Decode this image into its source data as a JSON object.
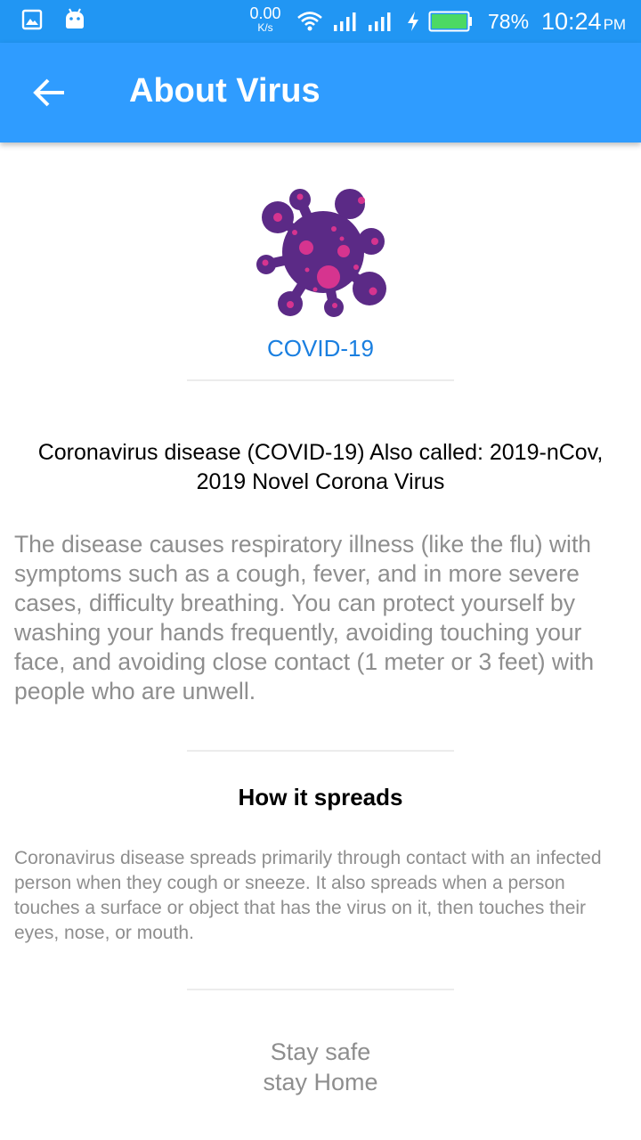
{
  "status_bar": {
    "left_icons": [
      "image-icon",
      "android-icon"
    ],
    "speed_value": "0.00",
    "speed_unit": "K/s",
    "battery_percent": "78%",
    "time": "10:24",
    "ampm": "PM",
    "right_icons": [
      "wifi-icon",
      "signal-icon",
      "signal-icon",
      "charging-icon",
      "battery-icon"
    ]
  },
  "app_bar": {
    "title": "About Virus",
    "back_icon": "arrow-left-icon"
  },
  "virus": {
    "label": "COVID-19",
    "icon": "virus-icon"
  },
  "headline": "Coronavirus disease (COVID-19) Also called: 2019-nCov, 2019 Novel Corona Virus",
  "description": "The disease causes respiratory illness (like the flu) with symptoms such as a cough, fever, and in more severe cases, difficulty breathing. You can protect yourself by washing your hands frequently, avoiding touching your face, and avoiding close contact (1 meter or 3 feet) with people who are unwell.",
  "spread": {
    "title": "How it spreads",
    "text": "Coronavirus disease spreads primarily through contact with an infected person when they cough or sneeze. It also spreads when a person touches a surface or object that has the virus on it, then touches their eyes, nose, or mouth."
  },
  "footer": {
    "line1": "Stay safe",
    "line2": "stay Home"
  },
  "colors": {
    "status_bar": "#2196f3",
    "app_bar": "#2f9cff",
    "accent_text": "#1a7fe0",
    "body_text": "#8e8e8e",
    "virus_body": "#5b2a86",
    "virus_spots": "#d6348f",
    "battery_fill": "#4cd964"
  }
}
